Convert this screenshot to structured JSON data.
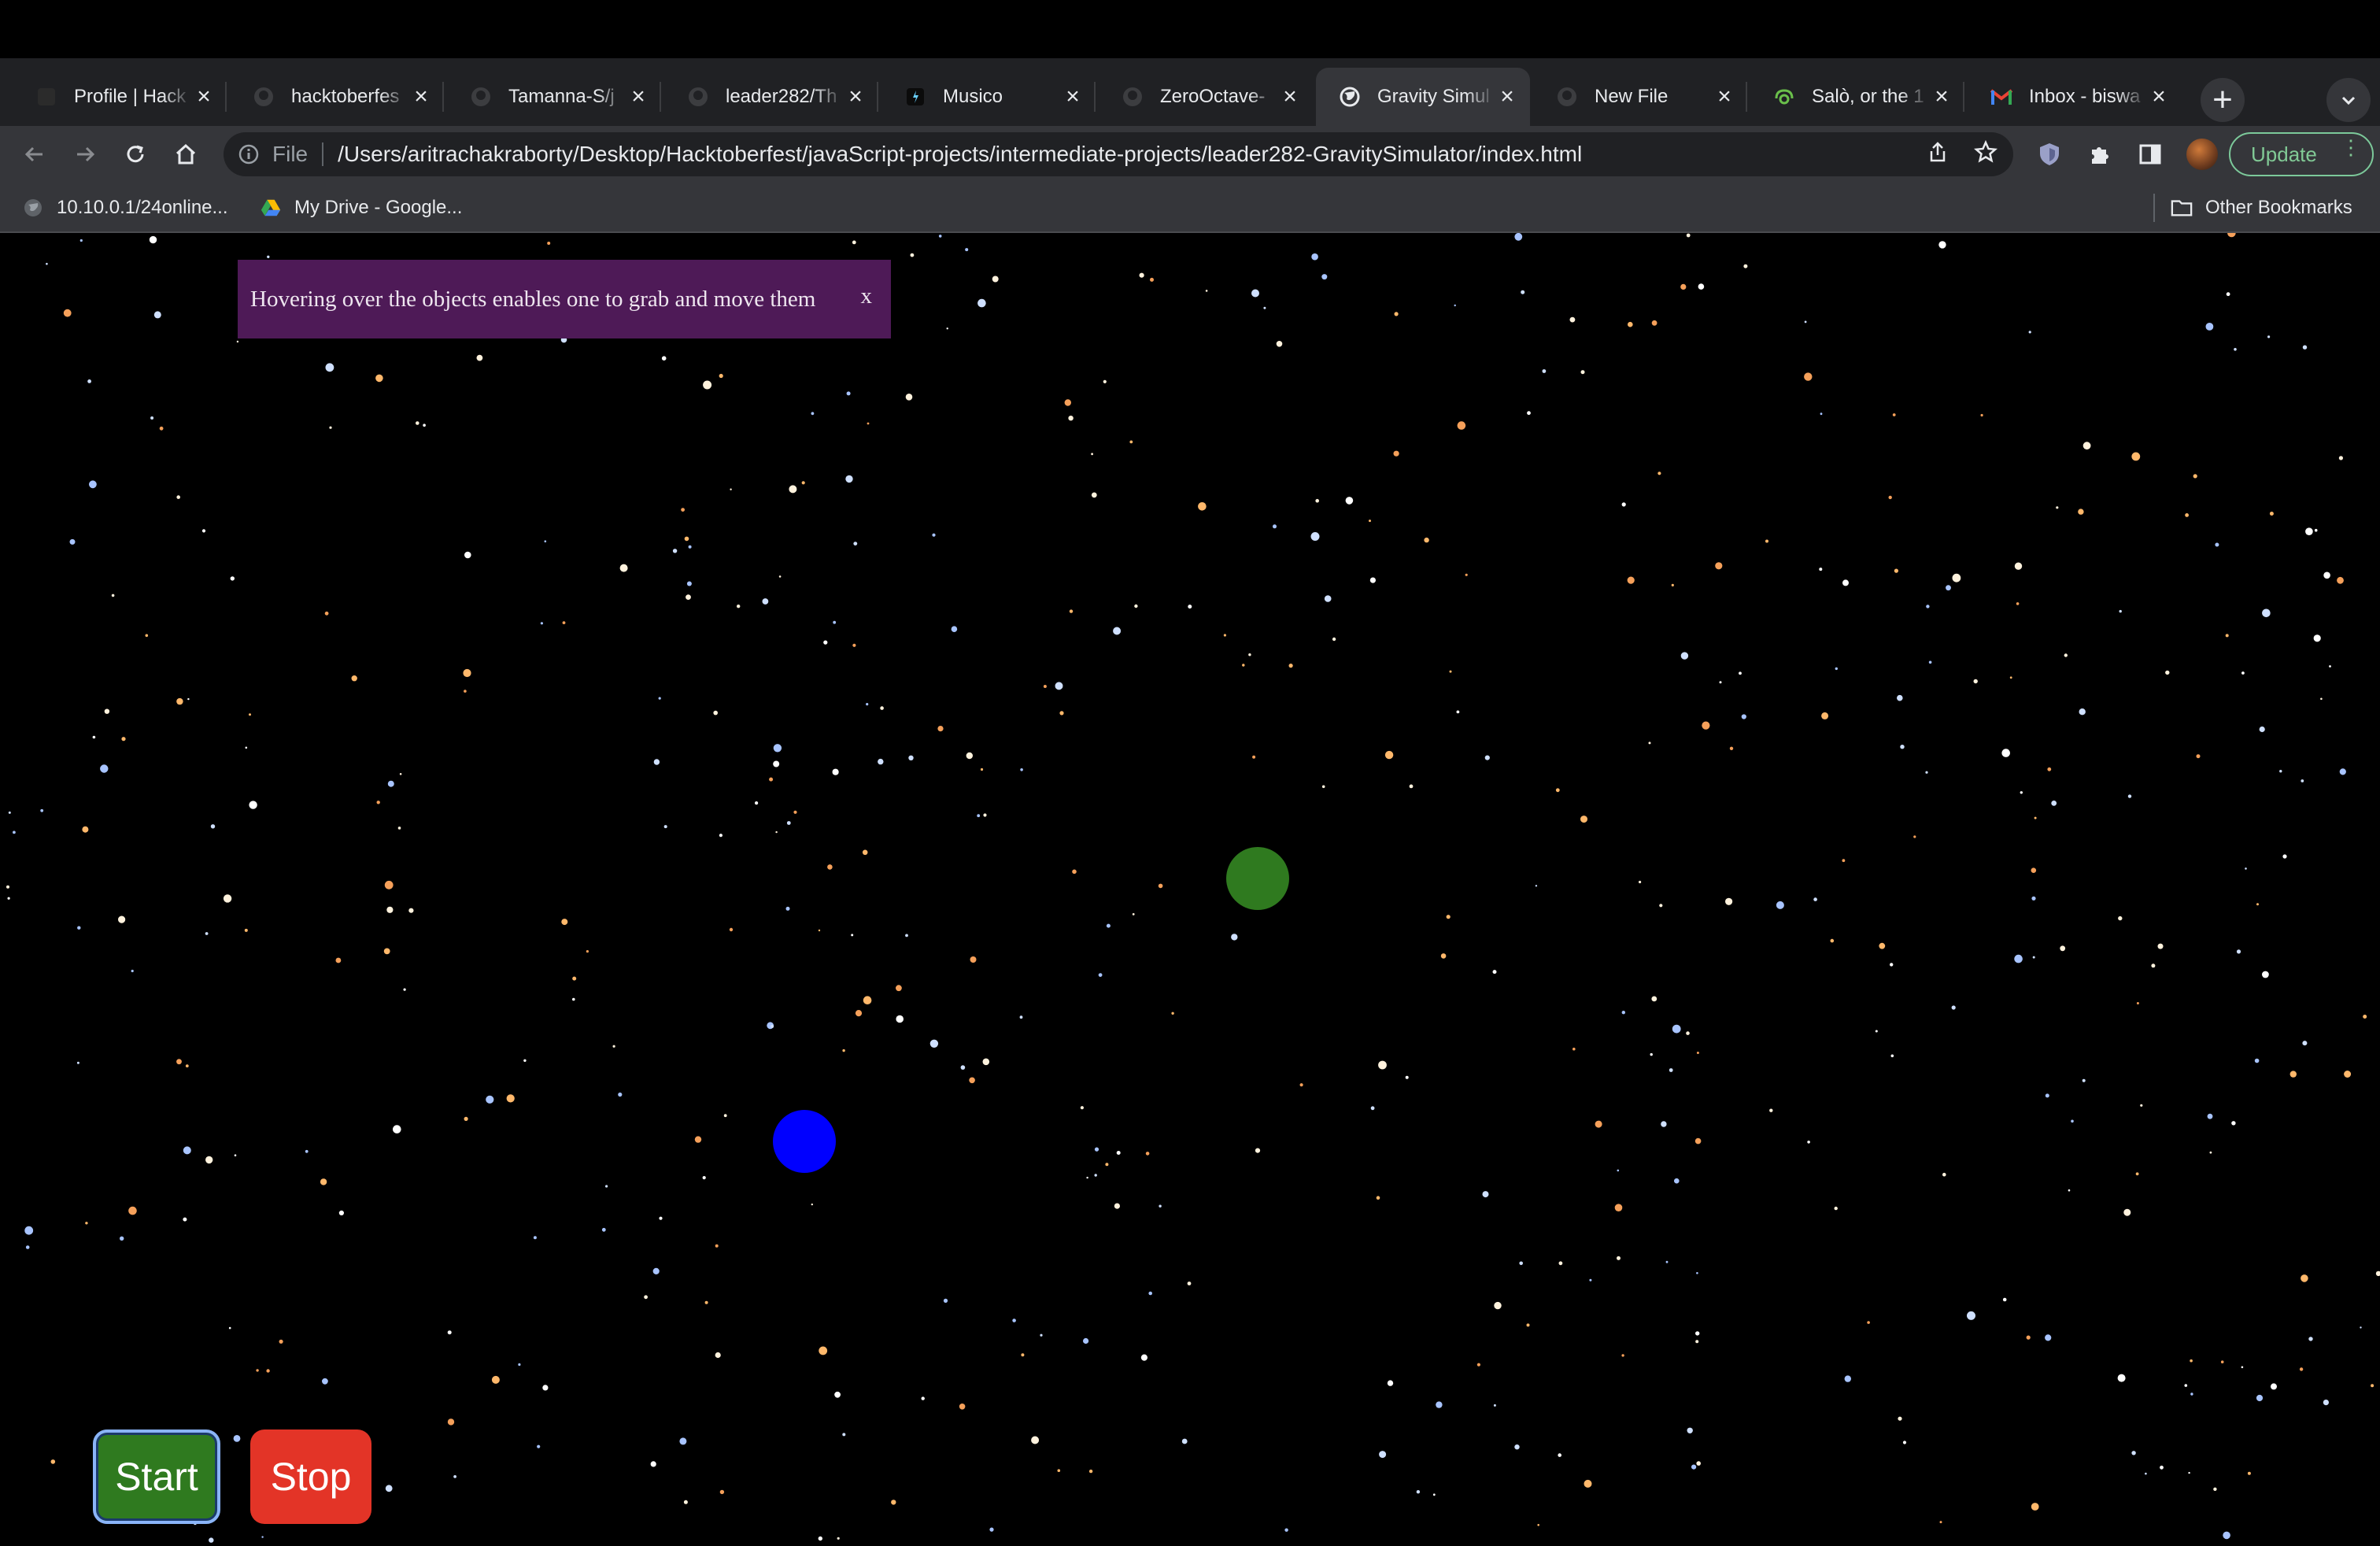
{
  "browser": {
    "tabs": [
      {
        "title": "Profile | Hack",
        "icon": "hackerrank-icon",
        "active": false
      },
      {
        "title": "hacktoberfes",
        "icon": "github-icon",
        "active": false
      },
      {
        "title": "Tamanna-S/j",
        "icon": "github-icon",
        "active": false
      },
      {
        "title": "leader282/Th",
        "icon": "github-icon",
        "active": false
      },
      {
        "title": "Musico",
        "icon": "music-icon",
        "active": false
      },
      {
        "title": "ZeroOctave-",
        "icon": "github-icon",
        "active": false
      },
      {
        "title": "Gravity Simul",
        "icon": "globe-icon",
        "active": true
      },
      {
        "title": "New File",
        "icon": "github-icon",
        "active": false
      },
      {
        "title": "Salò, or the 1",
        "icon": "tracker-icon",
        "active": false
      },
      {
        "title": "Inbox - biswa",
        "icon": "gmail-icon",
        "active": false
      }
    ],
    "address": {
      "scheme": "File",
      "url": "/Users/aritrachakraborty/Desktop/Hacktoberfest/javaScript-projects/intermediate-projects/leader282-GravitySimulator/index.html"
    },
    "update_label": "Update",
    "bookmarks": [
      {
        "label": "10.10.0.1/24online...",
        "icon": "globe-icon"
      },
      {
        "label": "My Drive - Google...",
        "icon": "google-drive-icon"
      }
    ],
    "other_bookmarks": "Other Bookmarks"
  },
  "page": {
    "tip_text": "Hovering over the objects enables one to grab and move them",
    "tip_close": "x",
    "start_label": "Start",
    "stop_label": "Stop",
    "colors": {
      "background": "#000000",
      "green_body": "#2f7a1f",
      "blue_body": "#0000ff",
      "tip_bg": "#4e1a57",
      "start_bg": "#2f7a1f",
      "stop_bg": "#e33427"
    }
  }
}
